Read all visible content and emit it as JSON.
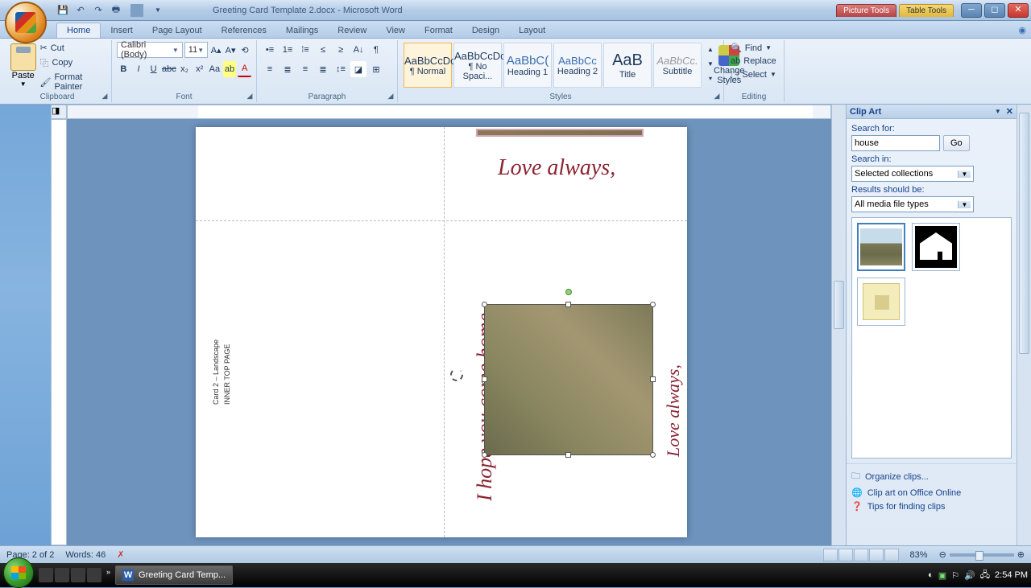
{
  "window": {
    "title": "Greeting Card Template 2.docx - Microsoft Word",
    "tool_tab1": "Picture Tools",
    "tool_tab2": "Table Tools"
  },
  "tabs": [
    "Home",
    "Insert",
    "Page Layout",
    "References",
    "Mailings",
    "Review",
    "View",
    "Format",
    "Design",
    "Layout"
  ],
  "active_tab": 0,
  "clipboard": {
    "paste": "Paste",
    "cut": "Cut",
    "copy": "Copy",
    "format_painter": "Format Painter",
    "group": "Clipboard"
  },
  "font": {
    "name": "Calibri (Body)",
    "size": "11",
    "group": "Font"
  },
  "paragraph": {
    "group": "Paragraph"
  },
  "styles": {
    "group": "Styles",
    "change": "Change Styles",
    "items": [
      {
        "preview": "AaBbCcDc",
        "name": "¶ Normal"
      },
      {
        "preview": "AaBbCcDc",
        "name": "¶ No Spaci..."
      },
      {
        "preview": "AaBbC(",
        "name": "Heading 1"
      },
      {
        "preview": "AaBbCc",
        "name": "Heading 2"
      },
      {
        "preview": "AaB",
        "name": "Title"
      },
      {
        "preview": "AaBbCc.",
        "name": "Subtitle"
      }
    ]
  },
  "editing": {
    "find": "Find",
    "replace": "Replace",
    "select": "Select",
    "group": "Editing"
  },
  "document": {
    "love": "Love always,",
    "hope": "I hope you come home",
    "love2": "Love always,",
    "caption1": "Card 2 – Landscape",
    "caption2": "INNER TOP PAGE"
  },
  "clipart": {
    "title": "Clip Art",
    "search_for": "Search for:",
    "search_value": "house",
    "go": "Go",
    "search_in": "Search in:",
    "search_in_value": "Selected collections",
    "results_should": "Results should be:",
    "results_value": "All media file types",
    "organize": "Organize clips...",
    "office_online": "Clip art on Office Online",
    "tips": "Tips for finding clips"
  },
  "status": {
    "page": "Page: 2 of 2",
    "words": "Words: 46",
    "zoom": "83%"
  },
  "taskbar": {
    "item": "Greeting Card Temp...",
    "time": "2:54 PM"
  }
}
